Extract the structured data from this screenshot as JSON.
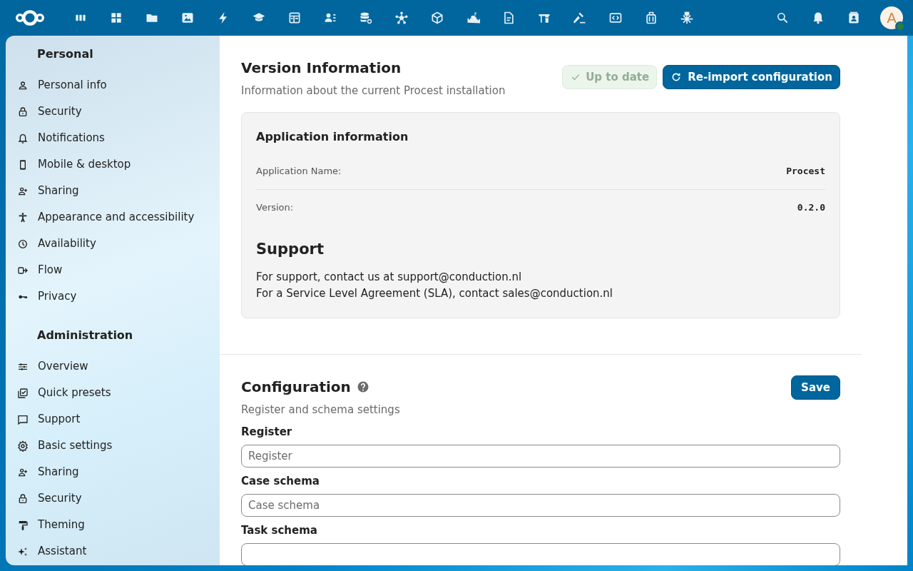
{
  "top_bar": {
    "avatar": {
      "initial": "A",
      "online": true
    }
  },
  "sidebar": {
    "sections": [
      {
        "title": "Personal",
        "items": [
          {
            "label": "Personal info"
          },
          {
            "label": "Security"
          },
          {
            "label": "Notifications"
          },
          {
            "label": "Mobile & desktop"
          },
          {
            "label": "Sharing"
          },
          {
            "label": "Appearance and accessibility"
          },
          {
            "label": "Availability"
          },
          {
            "label": "Flow"
          },
          {
            "label": "Privacy"
          }
        ]
      },
      {
        "title": "Administration",
        "items": [
          {
            "label": "Overview"
          },
          {
            "label": "Quick presets"
          },
          {
            "label": "Support"
          },
          {
            "label": "Basic settings"
          },
          {
            "label": "Sharing"
          },
          {
            "label": "Security"
          },
          {
            "label": "Theming"
          },
          {
            "label": "Assistant"
          }
        ]
      }
    ]
  },
  "version_section": {
    "title": "Version Information",
    "subtitle": "Information about the current Procest installation",
    "status_button": {
      "label": "Up to date",
      "disabled": true
    },
    "reimport_button": {
      "label": "Re-import configuration"
    },
    "card": {
      "title": "Application information",
      "rows": [
        {
          "label": "Application Name:",
          "value": "Procest"
        },
        {
          "label": "Version:",
          "value": "0.2.0"
        }
      ],
      "support_title": "Support",
      "support_lines": [
        "For support, contact us at support@conduction.nl",
        "For a Service Level Agreement (SLA), contact sales@conduction.nl"
      ]
    }
  },
  "configuration": {
    "title": "Configuration",
    "subtitle": "Register and schema settings",
    "save_button": "Save",
    "fields": [
      {
        "label": "Register",
        "placeholder": "Register"
      },
      {
        "label": "Case schema",
        "placeholder": "Case schema"
      },
      {
        "label": "Task schema"
      }
    ]
  }
}
